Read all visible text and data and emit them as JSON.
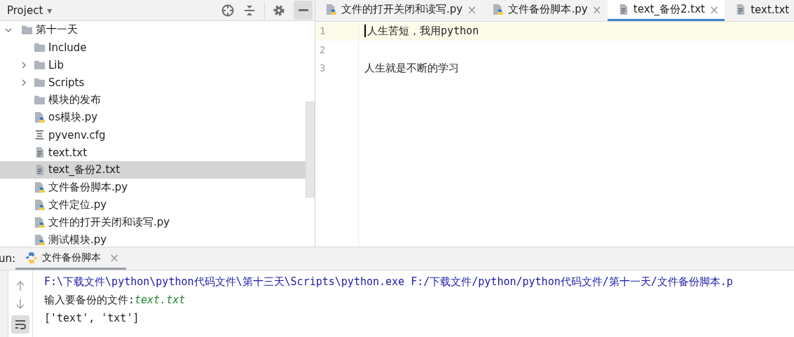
{
  "project_panel": {
    "title": "Project",
    "caret": "▾"
  },
  "tree": {
    "label": "第十一天",
    "kind": "folder",
    "expanded": true,
    "selected": false,
    "children": [
      {
        "label": "Include",
        "kind": "folder",
        "selected": false
      },
      {
        "label": "Lib",
        "kind": "folder",
        "expanded": false,
        "selected": false
      },
      {
        "label": "Scripts",
        "kind": "folder",
        "expanded": false,
        "selected": false
      },
      {
        "label": "模块的发布",
        "kind": "folder",
        "selected": false
      },
      {
        "label": "os模块.py",
        "kind": "python",
        "selected": false
      },
      {
        "label": "pyvenv.cfg",
        "kind": "config",
        "selected": false
      },
      {
        "label": "text.txt",
        "kind": "text",
        "selected": false
      },
      {
        "label": "text_备份2.txt",
        "kind": "text",
        "selected": true
      },
      {
        "label": "文件备份脚本.py",
        "kind": "python",
        "selected": false
      },
      {
        "label": "文件定位.py",
        "kind": "python",
        "selected": false
      },
      {
        "label": "文件的打开关闭和读写.py",
        "kind": "python",
        "selected": false
      },
      {
        "label": "测试模块.py",
        "kind": "python",
        "selected": false
      }
    ]
  },
  "editor_tabs": [
    {
      "label": "文件的打开关闭和读写.py",
      "kind": "python",
      "close": "×",
      "selected": false
    },
    {
      "label": "文件备份脚本.py",
      "kind": "python",
      "close": "×",
      "selected": false
    },
    {
      "label": "text_备份2.txt",
      "kind": "text",
      "close": "×",
      "selected": true
    },
    {
      "label": "text.txt",
      "kind": "text",
      "selected": false
    }
  ],
  "editor_lines": [
    {
      "number": "1",
      "text": "人生苦短，我用python",
      "current": true
    },
    {
      "number": "2",
      "current": false
    },
    {
      "number": "3",
      "text": "人生就是不断的学习",
      "current": false
    }
  ],
  "run_panel": {
    "label": "un:",
    "tab": {
      "label": "文件备份脚本",
      "close": "×"
    },
    "console": [
      {
        "kind": "command",
        "text": "F:\\下载文件\\python\\python代码文件\\第十三天\\Scripts\\python.exe F:/下载文件/python/python代码文件/第十一天/文件备份脚本.p"
      },
      {
        "kind": "prompt",
        "text": "输入要备份的文件:",
        "input": "text.txt"
      },
      {
        "kind": "output",
        "text": "['text', 'txt']"
      }
    ]
  }
}
